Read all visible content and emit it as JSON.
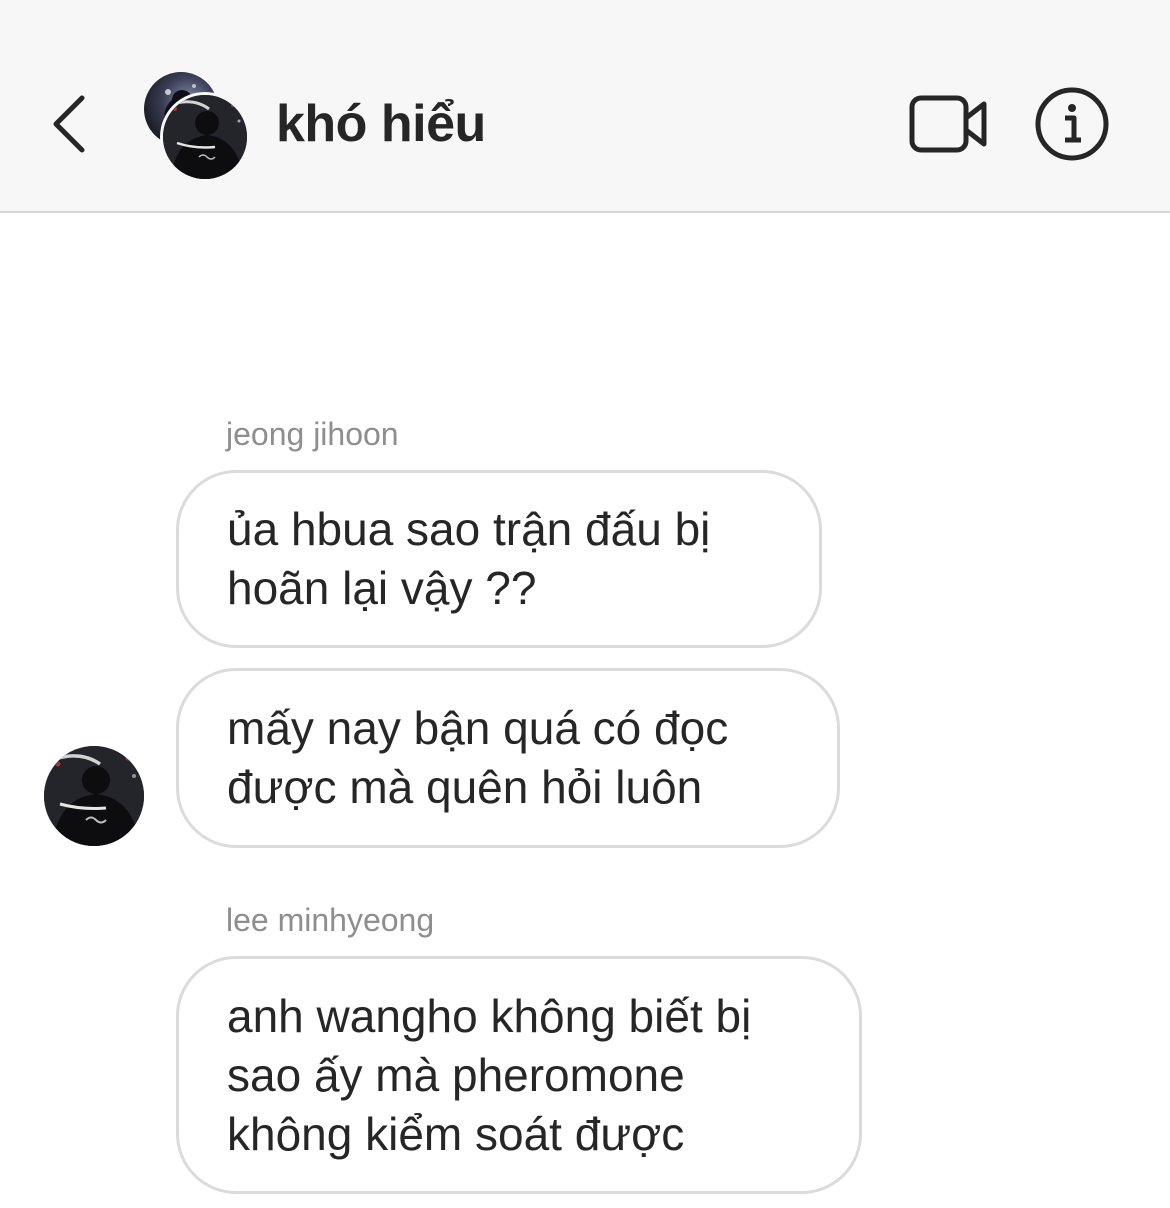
{
  "header": {
    "title": "khó hiểu",
    "back_icon": "chevron-left-icon",
    "video_icon": "video-camera-icon",
    "info_icon": "info-icon"
  },
  "messages": [
    {
      "sender": "jeong jihoon",
      "text": "ủa hbua sao trận đấu bị\nhoãn lại vậy ??"
    },
    {
      "sender": "",
      "text": "mấy nay bận quá có đọc\nđược mà quên hỏi luôn"
    },
    {
      "sender": "lee minhyeong",
      "text": "anh wangho không biết bị\nsao ấy mà pheromone\nkhông kiểm soát được"
    }
  ],
  "colors": {
    "header_bg": "#f7f7f7",
    "text_primary": "#262626",
    "text_secondary": "#8e8e8e",
    "bubble_border": "#dbdbdb"
  }
}
